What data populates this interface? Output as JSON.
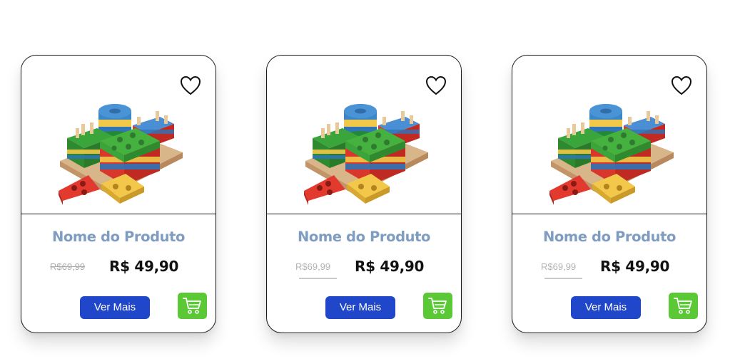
{
  "cards": [
    {
      "title": "Nome do Produto",
      "old_price": "R$69,99",
      "price": "R$ 49,90",
      "button_label": "Ver Mais",
      "old_price_style": "strikethrough"
    },
    {
      "title": "Nome do Produto",
      "old_price": "R$69,99",
      "price": "R$ 49,90",
      "button_label": "Ver Mais",
      "old_price_style": "underline"
    },
    {
      "title": "Nome do Produto",
      "old_price": "R$69,99",
      "price": "R$ 49,90",
      "button_label": "Ver Mais",
      "old_price_style": "underline"
    }
  ],
  "icons": {
    "favorite": "heart-outline-icon",
    "cart": "shopping-cart-icon"
  },
  "colors": {
    "title": "#7f9dc1",
    "button_primary": "#2047c9",
    "button_cart": "#5bc935",
    "price": "#111111",
    "old_price": "#b3b3b3"
  }
}
